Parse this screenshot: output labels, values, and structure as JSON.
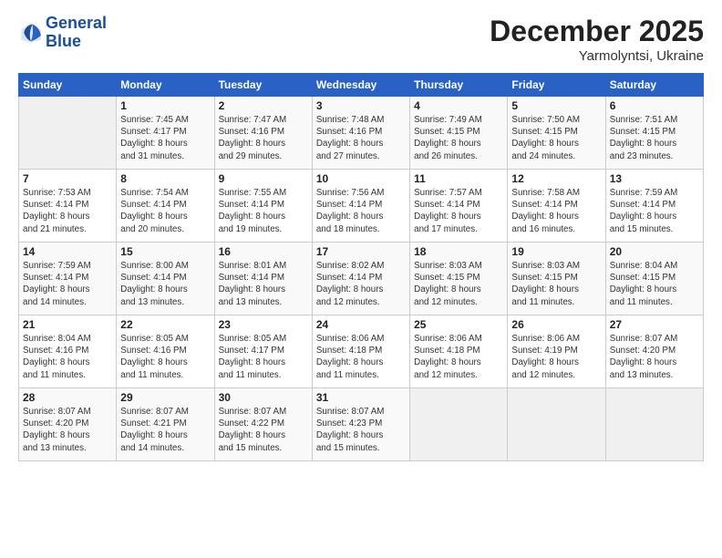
{
  "header": {
    "logo_line1": "General",
    "logo_line2": "Blue",
    "month": "December 2025",
    "location": "Yarmolyntsi, Ukraine"
  },
  "weekdays": [
    "Sunday",
    "Monday",
    "Tuesday",
    "Wednesday",
    "Thursday",
    "Friday",
    "Saturday"
  ],
  "weeks": [
    [
      {
        "day": "",
        "info": ""
      },
      {
        "day": "1",
        "info": "Sunrise: 7:45 AM\nSunset: 4:17 PM\nDaylight: 8 hours\nand 31 minutes."
      },
      {
        "day": "2",
        "info": "Sunrise: 7:47 AM\nSunset: 4:16 PM\nDaylight: 8 hours\nand 29 minutes."
      },
      {
        "day": "3",
        "info": "Sunrise: 7:48 AM\nSunset: 4:16 PM\nDaylight: 8 hours\nand 27 minutes."
      },
      {
        "day": "4",
        "info": "Sunrise: 7:49 AM\nSunset: 4:15 PM\nDaylight: 8 hours\nand 26 minutes."
      },
      {
        "day": "5",
        "info": "Sunrise: 7:50 AM\nSunset: 4:15 PM\nDaylight: 8 hours\nand 24 minutes."
      },
      {
        "day": "6",
        "info": "Sunrise: 7:51 AM\nSunset: 4:15 PM\nDaylight: 8 hours\nand 23 minutes."
      }
    ],
    [
      {
        "day": "7",
        "info": "Sunrise: 7:53 AM\nSunset: 4:14 PM\nDaylight: 8 hours\nand 21 minutes."
      },
      {
        "day": "8",
        "info": "Sunrise: 7:54 AM\nSunset: 4:14 PM\nDaylight: 8 hours\nand 20 minutes."
      },
      {
        "day": "9",
        "info": "Sunrise: 7:55 AM\nSunset: 4:14 PM\nDaylight: 8 hours\nand 19 minutes."
      },
      {
        "day": "10",
        "info": "Sunrise: 7:56 AM\nSunset: 4:14 PM\nDaylight: 8 hours\nand 18 minutes."
      },
      {
        "day": "11",
        "info": "Sunrise: 7:57 AM\nSunset: 4:14 PM\nDaylight: 8 hours\nand 17 minutes."
      },
      {
        "day": "12",
        "info": "Sunrise: 7:58 AM\nSunset: 4:14 PM\nDaylight: 8 hours\nand 16 minutes."
      },
      {
        "day": "13",
        "info": "Sunrise: 7:59 AM\nSunset: 4:14 PM\nDaylight: 8 hours\nand 15 minutes."
      }
    ],
    [
      {
        "day": "14",
        "info": "Sunrise: 7:59 AM\nSunset: 4:14 PM\nDaylight: 8 hours\nand 14 minutes."
      },
      {
        "day": "15",
        "info": "Sunrise: 8:00 AM\nSunset: 4:14 PM\nDaylight: 8 hours\nand 13 minutes."
      },
      {
        "day": "16",
        "info": "Sunrise: 8:01 AM\nSunset: 4:14 PM\nDaylight: 8 hours\nand 13 minutes."
      },
      {
        "day": "17",
        "info": "Sunrise: 8:02 AM\nSunset: 4:14 PM\nDaylight: 8 hours\nand 12 minutes."
      },
      {
        "day": "18",
        "info": "Sunrise: 8:03 AM\nSunset: 4:15 PM\nDaylight: 8 hours\nand 12 minutes."
      },
      {
        "day": "19",
        "info": "Sunrise: 8:03 AM\nSunset: 4:15 PM\nDaylight: 8 hours\nand 11 minutes."
      },
      {
        "day": "20",
        "info": "Sunrise: 8:04 AM\nSunset: 4:15 PM\nDaylight: 8 hours\nand 11 minutes."
      }
    ],
    [
      {
        "day": "21",
        "info": "Sunrise: 8:04 AM\nSunset: 4:16 PM\nDaylight: 8 hours\nand 11 minutes."
      },
      {
        "day": "22",
        "info": "Sunrise: 8:05 AM\nSunset: 4:16 PM\nDaylight: 8 hours\nand 11 minutes."
      },
      {
        "day": "23",
        "info": "Sunrise: 8:05 AM\nSunset: 4:17 PM\nDaylight: 8 hours\nand 11 minutes."
      },
      {
        "day": "24",
        "info": "Sunrise: 8:06 AM\nSunset: 4:18 PM\nDaylight: 8 hours\nand 11 minutes."
      },
      {
        "day": "25",
        "info": "Sunrise: 8:06 AM\nSunset: 4:18 PM\nDaylight: 8 hours\nand 12 minutes."
      },
      {
        "day": "26",
        "info": "Sunrise: 8:06 AM\nSunset: 4:19 PM\nDaylight: 8 hours\nand 12 minutes."
      },
      {
        "day": "27",
        "info": "Sunrise: 8:07 AM\nSunset: 4:20 PM\nDaylight: 8 hours\nand 13 minutes."
      }
    ],
    [
      {
        "day": "28",
        "info": "Sunrise: 8:07 AM\nSunset: 4:20 PM\nDaylight: 8 hours\nand 13 minutes."
      },
      {
        "day": "29",
        "info": "Sunrise: 8:07 AM\nSunset: 4:21 PM\nDaylight: 8 hours\nand 14 minutes."
      },
      {
        "day": "30",
        "info": "Sunrise: 8:07 AM\nSunset: 4:22 PM\nDaylight: 8 hours\nand 15 minutes."
      },
      {
        "day": "31",
        "info": "Sunrise: 8:07 AM\nSunset: 4:23 PM\nDaylight: 8 hours\nand 15 minutes."
      },
      {
        "day": "",
        "info": ""
      },
      {
        "day": "",
        "info": ""
      },
      {
        "day": "",
        "info": ""
      }
    ]
  ]
}
